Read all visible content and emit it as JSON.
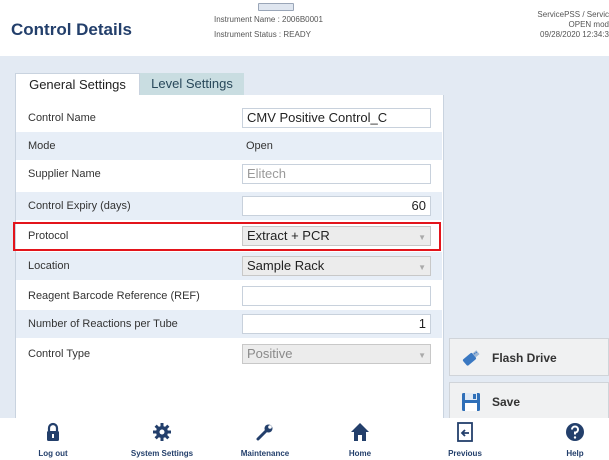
{
  "header": {
    "title": "Control Details",
    "instrument_name": "Instrument Name : 2006B0001",
    "instrument_status": "Instrument Status : READY",
    "user": "ServicePSS / Servic",
    "mode": "OPEN mod",
    "datetime": "09/28/2020 12:34:3"
  },
  "tabs": [
    {
      "label": "General Settings",
      "active": true
    },
    {
      "label": "Level Settings",
      "active": false
    }
  ],
  "form": {
    "control_name": {
      "label": "Control Name",
      "value": "CMV Positive Control_C"
    },
    "mode": {
      "label": "Mode",
      "value": "Open"
    },
    "supplier_name": {
      "label": "Supplier Name",
      "value": "Elitech"
    },
    "control_expiry": {
      "label": "Control Expiry (days)",
      "value": "60"
    },
    "protocol": {
      "label": "Protocol",
      "value": "Extract + PCR"
    },
    "location": {
      "label": "Location",
      "value": "Sample Rack"
    },
    "reagent_barcode": {
      "label": "Reagent Barcode Reference (REF)",
      "value": ""
    },
    "reactions_per_tube": {
      "label": "Number of Reactions per Tube",
      "value": "1"
    },
    "control_type": {
      "label": "Control Type",
      "value": "Positive"
    }
  },
  "side_buttons": {
    "flash_drive": "Flash Drive",
    "save": "Save"
  },
  "nav": {
    "logout": "Log out",
    "system_settings": "System Settings",
    "maintenance": "Maintenance",
    "home": "Home",
    "previous": "Previous",
    "help": "Help"
  },
  "colors": {
    "title": "#233f6b",
    "highlight": "#e3141b",
    "tab_inactive": "#c9dde1",
    "panel_bg": "#e3eaf3"
  }
}
